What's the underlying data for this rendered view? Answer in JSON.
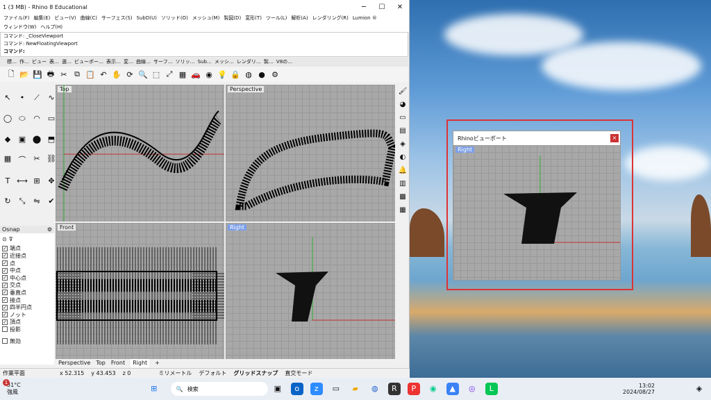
{
  "window": {
    "title": "1 (3 MB) - Rhino 8 Educational",
    "min": "─",
    "max": "☐",
    "close": "✕"
  },
  "menu": [
    "ファイル(F)",
    "編集(E)",
    "ビュー(V)",
    "曲線(C)",
    "サーフェス(S)",
    "SubD(U)",
    "ソリッド(O)",
    "メッシュ(M)",
    "製図(D)",
    "変形(T)",
    "ツール(L)",
    "解析(A)",
    "レンダリング(R)",
    "Lumion ®",
    "ウィンドウ(W)",
    "ヘルプ(H)"
  ],
  "command": {
    "lines": [
      "コマンド: _CloseViewport",
      "コマンド: NewFloatingViewport"
    ],
    "prompt": "コマンド:"
  },
  "tool_tabs": [
    "標…",
    "作…",
    "ビュー",
    "表…",
    "選…",
    "ビューポー…",
    "表示…",
    "変…",
    "曲線…",
    "サーフ…",
    "ソリッ…",
    "Sub…",
    "メッシ…",
    "レンダリ…",
    "製…",
    "V8の…"
  ],
  "viewports": {
    "top": "Top",
    "perspective": "Perspective",
    "front": "Front",
    "right": "Right"
  },
  "osnap": {
    "title": "Osnap",
    "items": [
      {
        "label": "端点",
        "checked": true
      },
      {
        "label": "近接点",
        "checked": true
      },
      {
        "label": "点",
        "checked": true
      },
      {
        "label": "中点",
        "checked": true
      },
      {
        "label": "中心点",
        "checked": true
      },
      {
        "label": "交点",
        "checked": true
      },
      {
        "label": "垂直点",
        "checked": true
      },
      {
        "label": "接点",
        "checked": true
      },
      {
        "label": "四半円点",
        "checked": true
      },
      {
        "label": "ノット",
        "checked": true
      },
      {
        "label": "頂点",
        "checked": true
      },
      {
        "label": "投影",
        "checked": false
      }
    ],
    "disable": "無効"
  },
  "vp_tabs": [
    "Perspective",
    "Top",
    "Front",
    "Right"
  ],
  "status": {
    "cplane": "作業平面",
    "x": "x 52.315",
    "y": "y 43.453",
    "z": "z 0",
    "units": "ミリメートル",
    "layer": "デフォルト",
    "gridsnap": "グリッドスナップ",
    "ortho": "直交モード"
  },
  "float": {
    "title": "Rhinoビューポート",
    "view": "Right"
  },
  "taskbar": {
    "temp": "31°C",
    "weather": "強風",
    "badge": "1",
    "search": "検索",
    "time": "13:02",
    "date": "2024/08/27"
  }
}
